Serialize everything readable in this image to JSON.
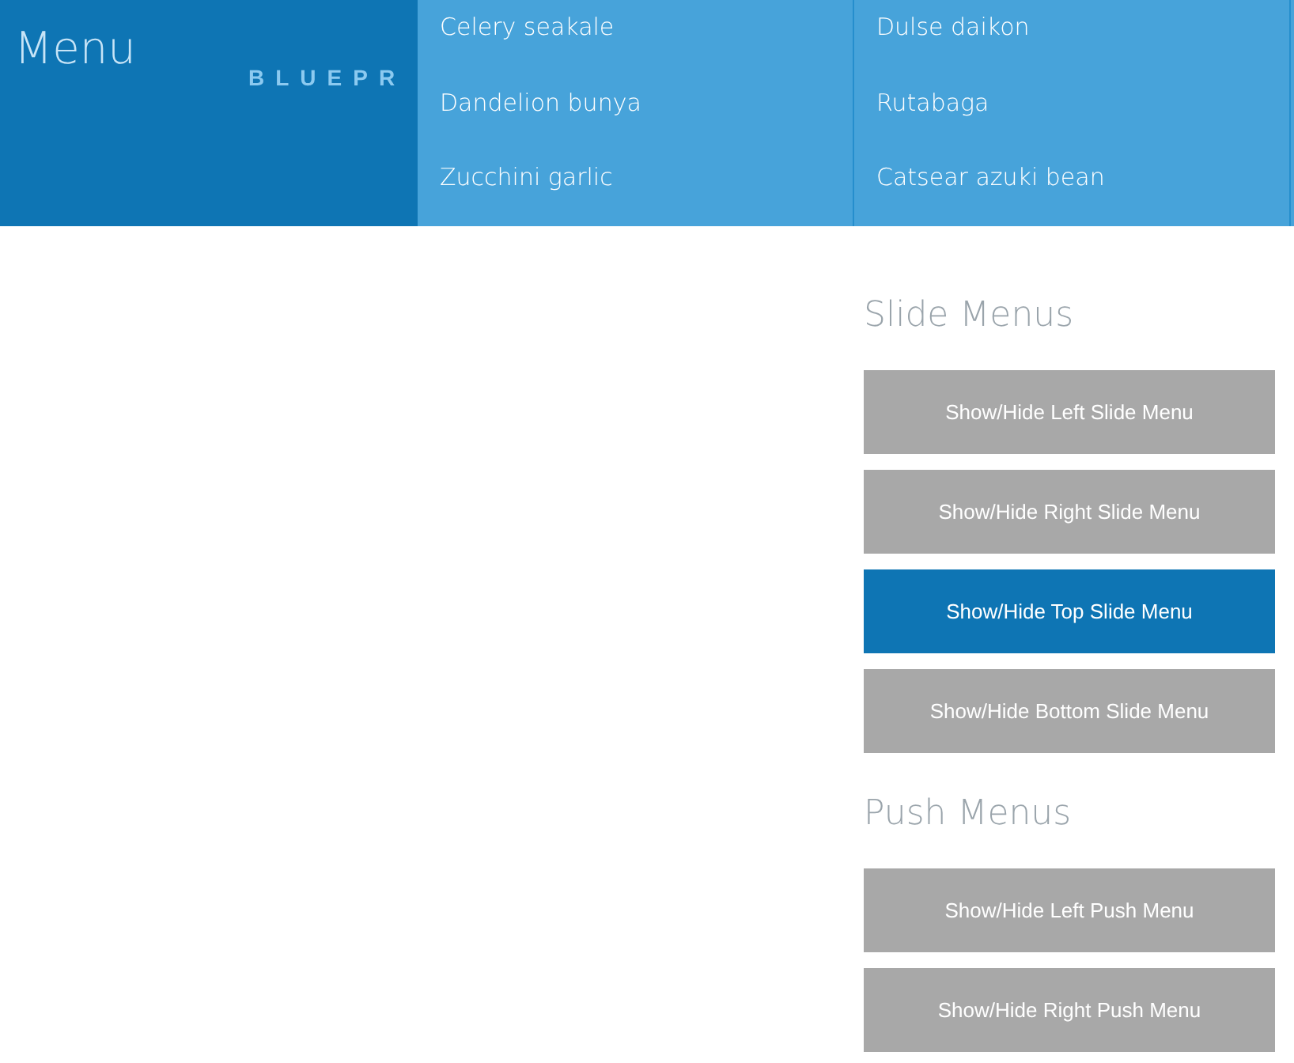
{
  "menu": {
    "title": "Menu",
    "brand": "BLUEPR",
    "columns": [
      [
        "Celery seakale",
        "Dandelion bunya",
        "Zucchini garlic"
      ],
      [
        "Dulse daikon",
        "Rutabaga",
        "Catsear azuki bean"
      ]
    ]
  },
  "sections": [
    {
      "heading": "Slide Menus",
      "buttons": [
        {
          "label": "Show/Hide Left Slide Menu",
          "selected": false
        },
        {
          "label": "Show/Hide Right Slide Menu",
          "selected": false
        },
        {
          "label": "Show/Hide Top Slide Menu",
          "selected": true
        },
        {
          "label": "Show/Hide Bottom Slide Menu",
          "selected": false
        }
      ]
    },
    {
      "heading": "Push Menus",
      "buttons": [
        {
          "label": "Show/Hide Left Push Menu",
          "selected": false
        },
        {
          "label": "Show/Hide Right Push Menu",
          "selected": false
        }
      ]
    }
  ]
}
